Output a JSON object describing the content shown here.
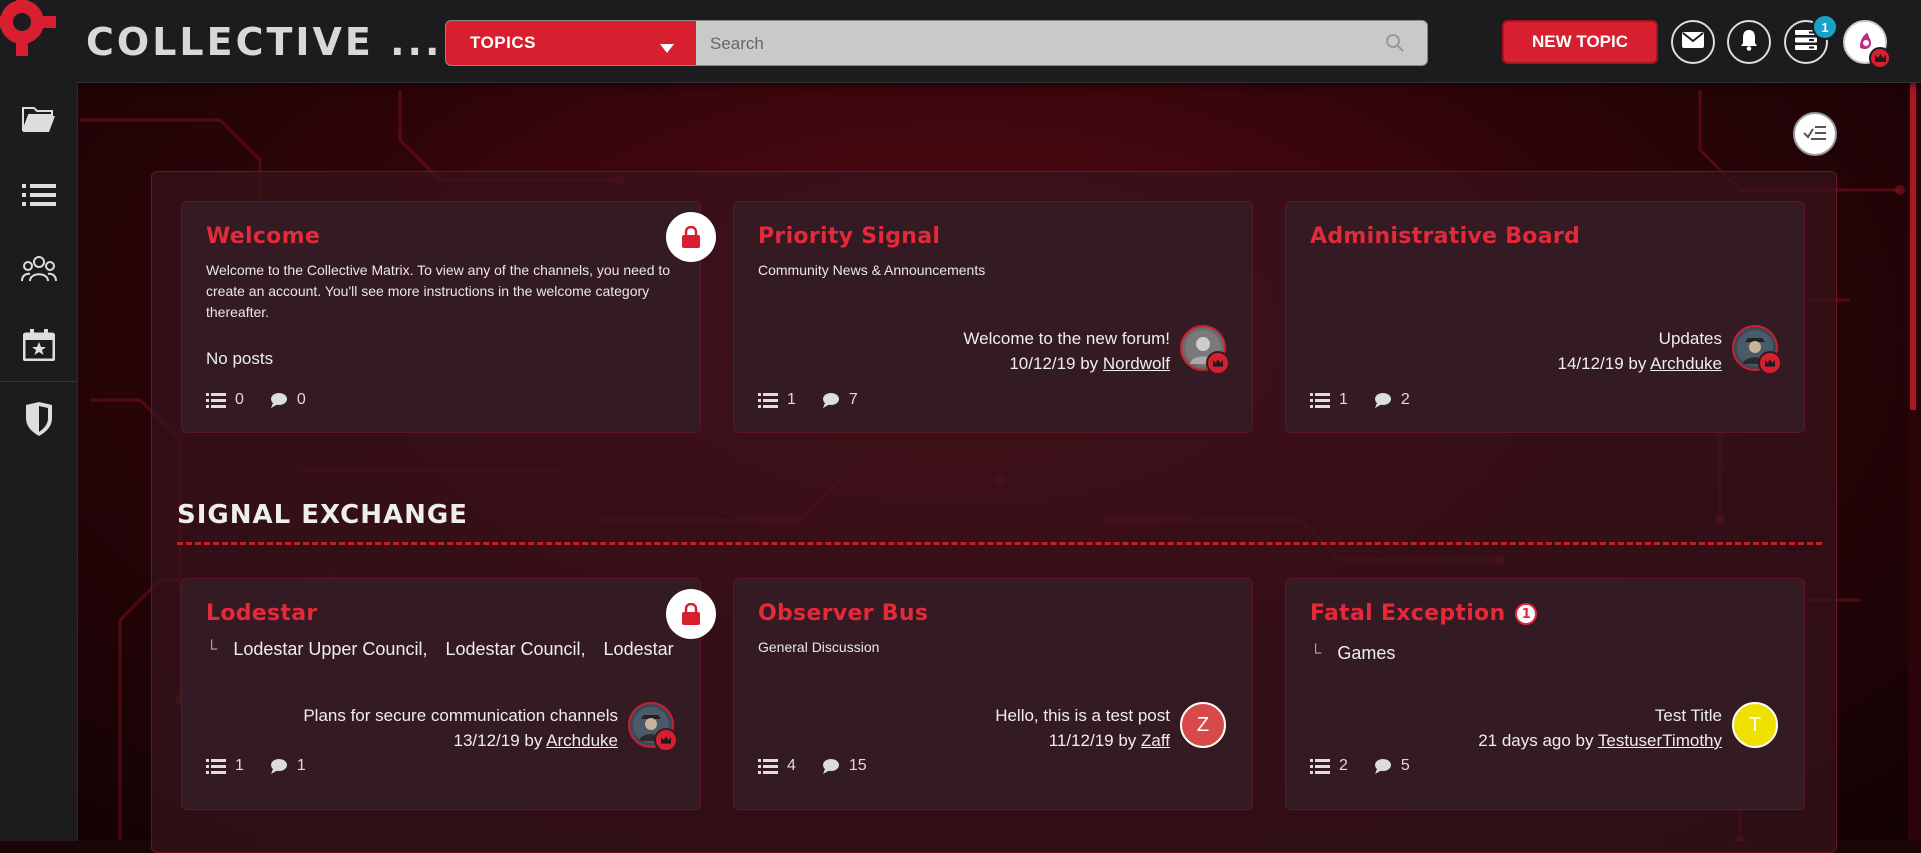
{
  "header": {
    "brand": "COLLECTIVE ...",
    "topics_select": "TOPICS",
    "search_placeholder": "Search",
    "new_topic_label": "NEW TOPIC",
    "notification_badge": "1",
    "accent_color": "#d81f2f"
  },
  "sidebar": {
    "items": [
      {
        "icon": "folder-icon"
      },
      {
        "icon": "list-icon"
      },
      {
        "icon": "users-icon"
      },
      {
        "icon": "calendar-star-icon"
      },
      {
        "icon": "shield-icon"
      }
    ]
  },
  "categories": [
    {
      "title": "Welcome",
      "description": "Welcome to the Collective Matrix. To view any of the channels, you need to create an account. You'll see more instructions in the welcome category thereafter.",
      "no_posts": "No posts",
      "topics": "0",
      "posts": "0",
      "locked": true
    },
    {
      "title": "Priority Signal",
      "description": "Community News & Announcements",
      "last_post_title": "Welcome to the new forum!",
      "last_post_date": "10/12/19 by",
      "last_post_user": "Nordwolf",
      "topics": "1",
      "posts": "7"
    },
    {
      "title": "Administrative Board",
      "last_post_title": "Updates",
      "last_post_date": "14/12/19 by",
      "last_post_user": "Archduke",
      "topics": "1",
      "posts": "2"
    }
  ],
  "section": {
    "title": "SIGNAL EXCHANGE"
  },
  "section_categories": [
    {
      "title": "Lodestar",
      "subcategories": [
        "Lodestar Upper Council,",
        "Lodestar Council,",
        "Lodestar"
      ],
      "last_post_title": "Plans for secure communication channels",
      "last_post_date": "13/12/19 by",
      "last_post_user": "Archduke",
      "topics": "1",
      "posts": "1",
      "locked": true
    },
    {
      "title": "Observer Bus",
      "description": "General Discussion",
      "last_post_title": "Hello, this is a test post",
      "last_post_date": "11/12/19 by",
      "last_post_user": "Zaff",
      "avatar_letter": "Z",
      "topics": "4",
      "posts": "15"
    },
    {
      "title": "Fatal Exception",
      "unread_count": "1",
      "subcategories": [
        "Games"
      ],
      "last_post_title": "Test Title",
      "last_post_date": "21 days ago by",
      "last_post_user": "TestuserTimothy",
      "avatar_letter": "T",
      "topics": "2",
      "posts": "5"
    }
  ]
}
